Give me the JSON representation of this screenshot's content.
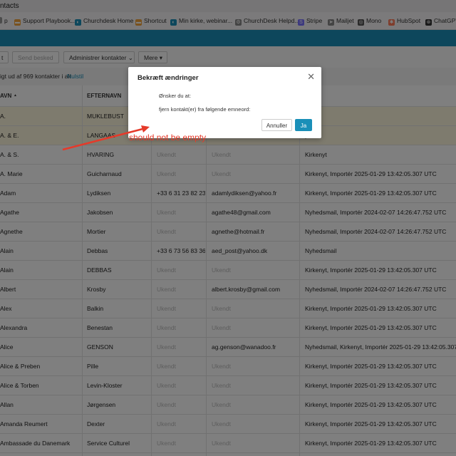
{
  "window": {
    "title": "ntacts"
  },
  "bookmarks": [
    {
      "label": "p",
      "icon": "blank-icon",
      "color": "#999999"
    },
    {
      "label": "Support Playbook...",
      "icon": "folder-icon",
      "color": "#f2a33a"
    },
    {
      "label": "Churchdesk Home",
      "icon": "churchdesk-icon",
      "color": "#1a8fb8"
    },
    {
      "label": "Shortcut",
      "icon": "folder-icon",
      "color": "#f2a33a"
    },
    {
      "label": "Min kirke, webinar...",
      "icon": "churchdesk-icon",
      "color": "#1a8fb8"
    },
    {
      "label": "ChurchDesk Helpd...",
      "icon": "gear-icon",
      "color": "#888888"
    },
    {
      "label": "Stripe",
      "icon": "stripe-icon",
      "color": "#7a73ff"
    },
    {
      "label": "Mailjet",
      "icon": "send-icon",
      "color": "#888888"
    },
    {
      "label": "Mono",
      "icon": "mono-icon",
      "color": "#555555"
    },
    {
      "label": "HubSpot",
      "icon": "hubspot-icon",
      "color": "#ff7a59"
    },
    {
      "label": "ChatGPT",
      "icon": "chatgpt-icon",
      "color": "#333333"
    }
  ],
  "toolbar": {
    "first_label": "t",
    "send_label": "Send besked",
    "manage_label": "Administrer kontakter",
    "more_label": "Mere"
  },
  "info": {
    "text": "igt ud af 969 kontakter i alt",
    "reset": "Nulstil"
  },
  "table": {
    "headers": [
      "AVN",
      "EFTERNAVN",
      "",
      "",
      "RD"
    ],
    "rows": [
      [
        "A.",
        "MUKLEBUST",
        "",
        "",
        "yt"
      ],
      [
        "A. & E.",
        "LANGAAS",
        "",
        "",
        "yt"
      ],
      [
        "A. & S.",
        "HVARING",
        "Ukendt",
        "Ukendt",
        "Kirkenyt"
      ],
      [
        "A. Marie",
        "Guicharnaud",
        "Ukendt",
        "Ukendt",
        "Kirkenyt, Importér 2025-01-29 13:42:05.307 UTC"
      ],
      [
        "Adam",
        "Lydiksen",
        "+33 6 31 23 82 23",
        "adamlydiksen@yahoo.fr",
        "Kirkenyt, Importér 2025-01-29 13:42:05.307 UTC"
      ],
      [
        "Agathe",
        "Jakobsen",
        "Ukendt",
        "agathe48@gmail.com",
        "Nyhedsmail, Importér 2024-02-07 14:26:47.752 UTC"
      ],
      [
        "Agnethe",
        "Mortier",
        "Ukendt",
        "agnethe@hotmail.fr",
        "Nyhedsmail, Importér 2024-02-07 14:26:47.752 UTC"
      ],
      [
        "Alain",
        "Debbas",
        "+33 6 73 56 83 36",
        "aed_post@yahoo.dk",
        "Nyhedsmail"
      ],
      [
        "Alain",
        "DEBBAS",
        "Ukendt",
        "Ukendt",
        "Kirkenyt, Importér 2025-01-29 13:42:05.307 UTC"
      ],
      [
        "Albert",
        "Krosby",
        "Ukendt",
        "albert.krosby@gmail.com",
        "Nyhedsmail, Importér 2024-02-07 14:26:47.752 UTC"
      ],
      [
        "Alex",
        "Balkin",
        "Ukendt",
        "Ukendt",
        "Kirkenyt, Importér 2025-01-29 13:42:05.307 UTC"
      ],
      [
        "Alexandra",
        "Benestan",
        "Ukendt",
        "Ukendt",
        "Kirkenyt, Importér 2025-01-29 13:42:05.307 UTC"
      ],
      [
        "Alice",
        "GENSON",
        "Ukendt",
        "ag.genson@wanadoo.fr",
        "Nyhedsmail, Kirkenyt, Importér 2025-01-29 13:42:05.307 UTC"
      ],
      [
        "Alice & Preben",
        "Pille",
        "Ukendt",
        "Ukendt",
        "Kirkenyt, Importér 2025-01-29 13:42:05.307 UTC"
      ],
      [
        "Alice & Torben",
        "Levin-Kloster",
        "Ukendt",
        "Ukendt",
        "Kirkenyt, Importér 2025-01-29 13:42:05.307 UTC"
      ],
      [
        "Allan",
        "Jørgensen",
        "Ukendt",
        "Ukendt",
        "Kirkenyt, Importér 2025-01-29 13:42:05.307 UTC"
      ],
      [
        "Amanda Reumert",
        "Dexter",
        "Ukendt",
        "Ukendt",
        "Kirkenyt, Importér 2025-01-29 13:42:05.307 UTC"
      ],
      [
        "Ambassade du Danemark",
        "Service Culturel",
        "Ukendt",
        "Ukendt",
        "Kirkenyt, Importér 2025-01-29 13:42:05.307 UTC"
      ]
    ]
  },
  "modal": {
    "title": "Bekræft ændringer",
    "line1": "Ønsker du at:",
    "line2": "fjern kontakt(er) fra følgende emneord:",
    "cancel": "Annuller",
    "confirm": "Ja"
  },
  "annotation": {
    "text": "should not be empty",
    "color": "#e53a2a"
  }
}
